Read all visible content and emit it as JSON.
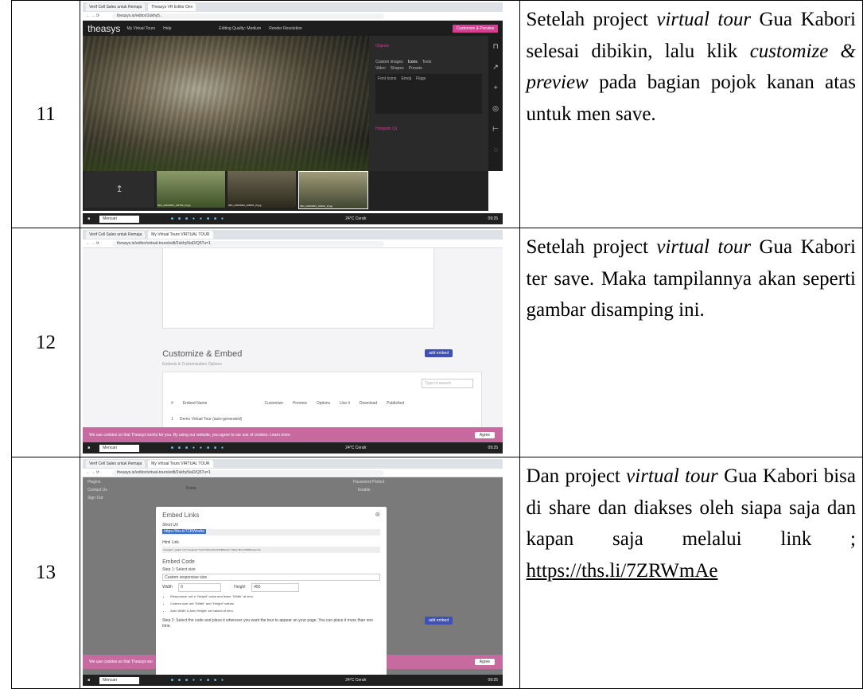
{
  "rows": [
    {
      "number": "11",
      "description_html": "Setelah project <i>virtual tour</i> Gua Kabori selesai dibikin, lalu klik <i>customize &amp; preview</i> pada bagian pojok kanan atas untuk men save.",
      "screenshot": {
        "tabs": [
          "Verif Cell Sales untuk Remaja",
          "Theasys VR Editor Dev"
        ],
        "url": "theasys.io/editor/2ukhy5..",
        "brand": "theasys",
        "nav": [
          "My Virtual Tours",
          "Help"
        ],
        "toolbar": [
          "Editing Quality: Medium",
          "Render Resolution"
        ],
        "cta": "Customize & Preview",
        "panel_title": "Objects",
        "panel_tabs": [
          "Custom images",
          "Icons",
          "Texts"
        ],
        "panel_tabs2": [
          "Video",
          "Shapes",
          "Presets"
        ],
        "panel_subtabs": [
          "Font Icons",
          "Emoji",
          "Flags"
        ],
        "hotspots": "Hotspots (1)",
        "thumb_labels": [
          "IMG_20220903_102702_0r.jpg",
          "IMG_20220903_102801_0r.jpg",
          "IMG_20220903_103011_0r.jpg"
        ],
        "taskbar_search": "Mencari",
        "clock": "09:25",
        "date": "02/09/2022",
        "weather": "24°C Cerah"
      }
    },
    {
      "number": "12",
      "description_html": "Setelah project <i>virtual tour</i> Gua Kabori ter save. Maka tampilannya akan seperti gambar disamping ini.",
      "screenshot": {
        "tabs": [
          "Verif Cell Sales untuk Remaja",
          "My Virtual Tours VIRTUAL TOUR"
        ],
        "url": "theasys.io/editor/virtual-tours/edit/2ukhy5iaD/Q5?u=1",
        "section_title": "Customize & Embed",
        "section_sub": "Embeds & Customization Options",
        "add_embed": "add embed",
        "search_placeholder": "Type to search",
        "columns": [
          "#",
          "Embed Name",
          "Customize",
          "Preview",
          "Options",
          "Use it",
          "Download",
          "Published"
        ],
        "row": [
          "1",
          "Demo Virtual Tour (auto-generated)"
        ],
        "cookie_text": "We use cookies so that Theasys works for you. By using our website, you agree to our use of cookies. Learn more",
        "agree": "Agree",
        "taskbar_search": "Mencari",
        "clock": "09:25",
        "weather": "24°C Cerah"
      }
    },
    {
      "number": "13",
      "description_html": "Dan project <i>virtual tour</i> Gua Kabori bisa di share dan diakses oleh siapa saja dan kapan saja melalui link ; <span class=\"link\">https://ths.li/7ZRWmAe</span>",
      "screenshot": {
        "tabs": [
          "Verif Cell Sales untuk Remaja",
          "My Virtual Tours VIRTUAL TOUR"
        ],
        "url": "theasys.io/editor/virtual-tours/edit/2ukhy5iaD/Q5?u=1",
        "side_items": [
          "Plugins",
          "Contact Us",
          "Sign Out"
        ],
        "modal_title": "Embed Links",
        "short_url_label": "Short Url",
        "short_url": "https://ths.li/7ZRWmAe",
        "html_link_label": "Html Link",
        "html_link": "<a target=\"_blank\" rel=\"noopener\" href=\"https://ths.li/7ZRWmAe\">https://ths.li/7ZRWmAe</a>",
        "embed_code": "Embed Code",
        "step1": "Step 1: Select size",
        "size_option": "Custom responsive size",
        "width_label": "Width",
        "width_value": "0",
        "height_label": "Height",
        "height_value": "450",
        "bullets": [
          "Responsive: set a \"Height\" value and leave \"Width\" at zero.",
          "Custom size: set \"Width\" and \"Height\" values.",
          "Auto Width & Auto Height: set values at zero."
        ],
        "step2": "Step 2: Select the code and place it wherever you want the tour to appear on your page. You can place it more than one time.",
        "password_protect": "Password Protect",
        "enable": "Enable",
        "fonts": "Fonts",
        "add_embed": "add embed",
        "cookie_text": "We use cookies so that Theasys wo",
        "agree": "Agree",
        "taskbar_search": "Mencari",
        "clock": "09:25",
        "weather": "24°C Cerah"
      }
    }
  ]
}
